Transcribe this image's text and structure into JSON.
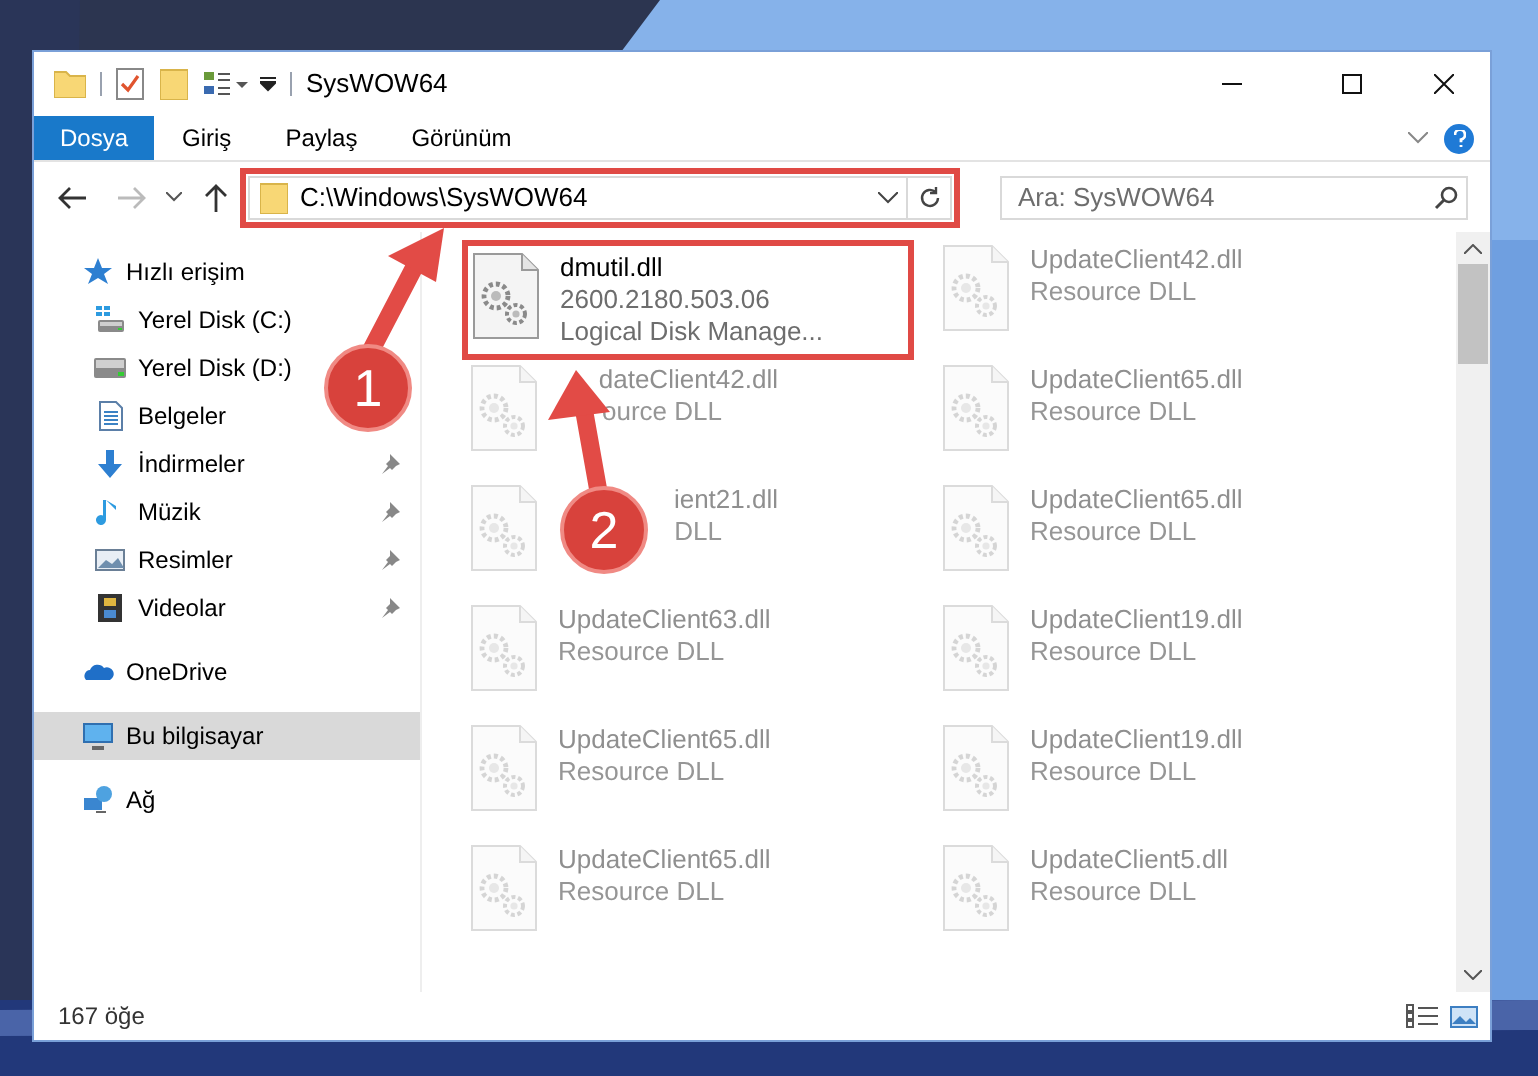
{
  "window": {
    "title": "SysWOW64"
  },
  "ribbon_tabs": [
    {
      "label": "Dosya",
      "selected": true
    },
    {
      "label": "Giriş",
      "selected": false
    },
    {
      "label": "Paylaş",
      "selected": false
    },
    {
      "label": "Görünüm",
      "selected": false
    }
  ],
  "address_bar": {
    "path": "C:\\Windows\\SysWOW64",
    "highlighted": true
  },
  "search": {
    "placeholder": "Ara: SysWOW64"
  },
  "navigation": [
    {
      "label": "Hızlı erişim",
      "kind": "star",
      "selected": false,
      "children": [
        {
          "label": "Yerel Disk (C:)",
          "kind": "drive_c",
          "pinned": false
        },
        {
          "label": "Yerel Disk (D:)",
          "kind": "drive",
          "pinned": false
        },
        {
          "label": "Belgeler",
          "kind": "documents",
          "pinned": false
        },
        {
          "label": "İndirmeler",
          "kind": "download",
          "pinned": true
        },
        {
          "label": "Müzik",
          "kind": "music",
          "pinned": true
        },
        {
          "label": "Resimler",
          "kind": "pictures",
          "pinned": true
        },
        {
          "label": "Videolar",
          "kind": "video",
          "pinned": true
        }
      ]
    },
    {
      "label": "OneDrive",
      "kind": "cloud",
      "selected": false
    },
    {
      "label": "Bu bilgisayar",
      "kind": "computer",
      "selected": true
    },
    {
      "label": "Ağ",
      "kind": "network",
      "selected": false
    }
  ],
  "files": [
    {
      "name": "dmutil.dll",
      "details": [
        "2600.2180.503.06",
        "Logical Disk Manage..."
      ],
      "kind": "plain",
      "faded": false,
      "highlighted": true
    },
    {
      "name": "UpdateClient42.dll",
      "details": [
        "Resource DLL"
      ],
      "kind": "plain",
      "faded": true,
      "highlighted": false
    },
    {
      "name": "dateClient42.dll",
      "details": [
        "ource DLL"
      ],
      "kind": "covered",
      "faded": true,
      "highlighted": false
    },
    {
      "name": "UpdateClient65.dll",
      "details": [
        "Resource DLL"
      ],
      "kind": "plain",
      "faded": true,
      "highlighted": false
    },
    {
      "name": "ient21.dll",
      "details": [
        "DLL"
      ],
      "kind": "covered",
      "faded": true,
      "highlighted": false
    },
    {
      "name": "UpdateClient65.dll",
      "details": [
        "Resource DLL"
      ],
      "kind": "plain",
      "faded": true,
      "highlighted": false
    },
    {
      "name": "UpdateClient63.dll",
      "details": [
        "Resource DLL"
      ],
      "kind": "plain",
      "faded": true,
      "highlighted": false
    },
    {
      "name": "UpdateClient19.dll",
      "details": [
        "Resource DLL"
      ],
      "kind": "plain",
      "faded": true,
      "highlighted": false
    },
    {
      "name": "UpdateClient65.dll",
      "details": [
        "Resource DLL"
      ],
      "kind": "plain",
      "faded": true,
      "highlighted": false
    },
    {
      "name": "UpdateClient19.dll",
      "details": [
        "Resource DLL"
      ],
      "kind": "plain",
      "faded": true,
      "highlighted": false
    },
    {
      "name": "UpdateClient65.dll",
      "details": [
        "Resource DLL"
      ],
      "kind": "plain",
      "faded": true,
      "highlighted": false
    },
    {
      "name": "UpdateClient5.dll",
      "details": [
        "Resource DLL"
      ],
      "kind": "plain",
      "faded": true,
      "highlighted": false
    }
  ],
  "status_bar": {
    "item_count": "167 öğe"
  },
  "annotations": [
    {
      "number": "1"
    },
    {
      "number": "2"
    }
  ]
}
